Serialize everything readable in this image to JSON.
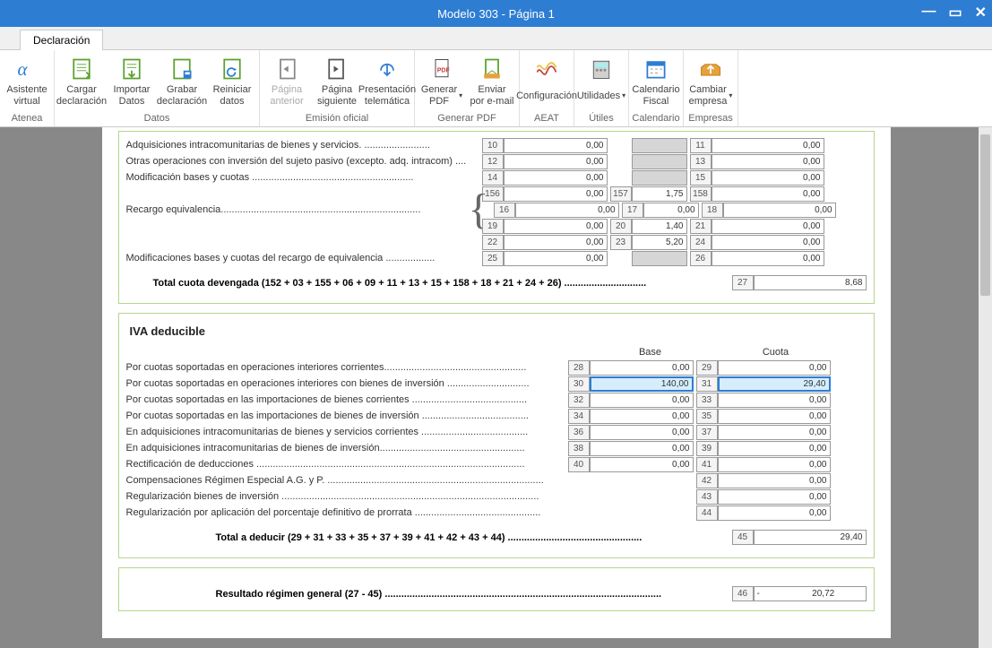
{
  "window": {
    "title": "Modelo 303 - Página 1"
  },
  "tab": {
    "label": "Declaración"
  },
  "ribbon": {
    "groups": [
      {
        "name": "Atenea",
        "items": [
          {
            "id": "asistente",
            "l1": "Asistente",
            "l2": "virtual"
          }
        ]
      },
      {
        "name": "Datos",
        "items": [
          {
            "id": "cargar",
            "l1": "Cargar",
            "l2": "declaración"
          },
          {
            "id": "importar",
            "l1": "Importar",
            "l2": "Datos"
          },
          {
            "id": "grabar",
            "l1": "Grabar",
            "l2": "declaración"
          },
          {
            "id": "reiniciar",
            "l1": "Reiniciar",
            "l2": "datos"
          }
        ]
      },
      {
        "name": "Emisión oficial",
        "items": [
          {
            "id": "pag-ant",
            "l1": "Página",
            "l2": "anterior",
            "disabled": true
          },
          {
            "id": "pag-sig",
            "l1": "Página",
            "l2": "siguiente"
          },
          {
            "id": "pres-tel",
            "l1": "Presentación",
            "l2": "telemática"
          }
        ]
      },
      {
        "name": "Generar PDF",
        "items": [
          {
            "id": "gen-pdf",
            "l1": "Generar",
            "l2": "PDF ",
            "chev": true
          },
          {
            "id": "enviar",
            "l1": "Enviar",
            "l2": "por e-mail"
          }
        ]
      },
      {
        "name": "AEAT",
        "items": [
          {
            "id": "config",
            "l1": "Configuración",
            "l2": ""
          }
        ]
      },
      {
        "name": "Útiles",
        "items": [
          {
            "id": "utilidades",
            "l1": "Utilidades",
            "l2": "",
            "chev": true
          }
        ]
      },
      {
        "name": "Calendario",
        "items": [
          {
            "id": "calendario",
            "l1": "Calendario",
            "l2": "Fiscal"
          }
        ]
      },
      {
        "name": "Empresas",
        "items": [
          {
            "id": "cambiar",
            "l1": "Cambiar",
            "l2": "empresa ",
            "chev": true
          }
        ]
      }
    ]
  },
  "sec1": {
    "rows": [
      {
        "label": "Adquisiciones intracomunitarias de bienes y servicios. ........................",
        "c1": "10",
        "v1": "0,00",
        "c2": "",
        "v2": "",
        "c3": "11",
        "v3": "0,00"
      },
      {
        "label": "Otras operaciones con inversión del sujeto pasivo (excepto. adq. intracom) ....",
        "c1": "12",
        "v1": "0,00",
        "c2": "",
        "v2": "",
        "c3": "13",
        "v3": "0,00"
      },
      {
        "label": "Modificación bases y cuotas ...........................................................",
        "c1": "14",
        "v1": "0,00",
        "c2": "",
        "v2": "",
        "c3": "15",
        "v3": "0,00"
      },
      {
        "label": "",
        "c1": "156",
        "v1": "0,00",
        "c2": "157",
        "v2": "1,75",
        "c3": "158",
        "v3": "0,00"
      },
      {
        "label": "Recargo equivalencia.........................................................................",
        "c1": "16",
        "v1": "0,00",
        "c2": "17",
        "v2": "0,00",
        "c3": "18",
        "v3": "0,00",
        "brace": true
      },
      {
        "label": "",
        "c1": "19",
        "v1": "0,00",
        "c2": "20",
        "v2": "1,40",
        "c3": "21",
        "v3": "0,00"
      },
      {
        "label": "",
        "c1": "22",
        "v1": "0,00",
        "c2": "23",
        "v2": "5,20",
        "c3": "24",
        "v3": "0,00"
      },
      {
        "label": "Modificaciones bases y cuotas del recargo de equivalencia  ..................",
        "c1": "25",
        "v1": "0,00",
        "c2": "",
        "v2": "",
        "c3": "26",
        "v3": "0,00"
      }
    ],
    "total": {
      "label": "Total cuota devengada (152 + 03 + 155 + 06 + 09 + 11 + 13 + 15 + 158 + 18 + 21 + 24 + 26) ..............................",
      "c": "27",
      "v": "8,68"
    }
  },
  "sec2": {
    "title": "IVA deducible",
    "col1": "Base",
    "col2": "Cuota",
    "rows": [
      {
        "label": "Por cuotas soportadas en operaciones interiores corrientes....................................................",
        "c1": "28",
        "v1": "0,00",
        "c2": "29",
        "v3": "0,00"
      },
      {
        "label": "Por cuotas soportadas en operaciones interiores con bienes de inversión ..............................",
        "c1": "30",
        "v1": "140,00",
        "c2": "31",
        "v3": "29,40",
        "hl": true
      },
      {
        "label": "Por cuotas soportadas en las importaciones de bienes corrientes ..........................................",
        "c1": "32",
        "v1": "0,00",
        "c2": "33",
        "v3": "0,00"
      },
      {
        "label": "Por cuotas soportadas en las importaciones de bienes de inversión .......................................",
        "c1": "34",
        "v1": "0,00",
        "c2": "35",
        "v3": "0,00"
      },
      {
        "label": "En adquisiciones intracomunitarias de bienes y servicios corrientes .......................................",
        "c1": "36",
        "v1": "0,00",
        "c2": "37",
        "v3": "0,00"
      },
      {
        "label": "En adquisiciones intracomunitarias de bienes de inversión.....................................................",
        "c1": "38",
        "v1": "0,00",
        "c2": "39",
        "v3": "0,00"
      },
      {
        "label": "Rectificación de deducciones ..................................................................................................",
        "c1": "40",
        "v1": "0,00",
        "c2": "41",
        "v3": "0,00"
      },
      {
        "label": "Compensaciones Régimen Especial A.G. y P. ...............................................................................",
        "c1": "",
        "v1": "",
        "c2": "42",
        "v3": "0,00",
        "single": true
      },
      {
        "label": "Regularización bienes de inversión ..............................................................................................",
        "c1": "",
        "v1": "",
        "c2": "43",
        "v3": "0,00",
        "single": true
      },
      {
        "label": "Regularización por aplicación del porcentaje definitivo de prorrata ..............................................",
        "c1": "",
        "v1": "",
        "c2": "44",
        "v3": "0,00",
        "single": true
      }
    ],
    "total": {
      "label": "Total a deducir (29 + 31 + 33 + 35 + 37 + 39 + 41 + 42 + 43 + 44) .................................................",
      "c": "45",
      "v": "29,40"
    }
  },
  "sec3": {
    "label": "Resultado régimen general (27 - 45) .....................................................................................................",
    "c": "46",
    "v": "-                     20,72"
  }
}
